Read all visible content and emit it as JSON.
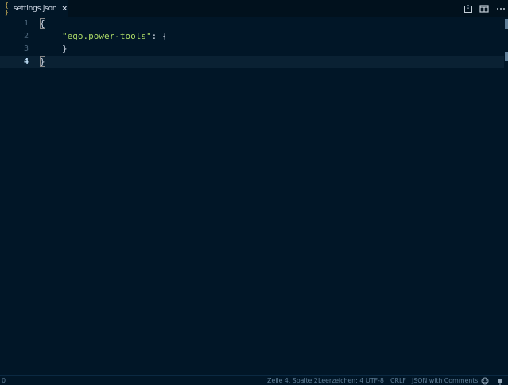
{
  "tab": {
    "icon": "{ }",
    "label": "settings.json",
    "close": "×"
  },
  "editor": {
    "line_numbers": [
      "1",
      "2",
      "3",
      "4"
    ],
    "active_line": "4",
    "lines": {
      "l1": "{",
      "l2_key": "\"ego.power-tools\"",
      "l2_rest": ": {",
      "l3": "}",
      "l4": "}"
    }
  },
  "status": {
    "left": "0",
    "position": "Zeile 4, Spalte 2",
    "indentation": "Leerzeichen: 4",
    "encoding": "UTF-8",
    "eol": "CRLF",
    "language": "JSON with Comments"
  },
  "icons": {
    "compare": "open-changes-icon",
    "split": "split-editor-icon",
    "more": "more-actions-icon",
    "feedback": "smiley-icon",
    "notifications": "bell-icon"
  },
  "colors": {
    "background": "#011627",
    "string": "#addb67",
    "line_number": "#4b6479",
    "active_line_number": "#c5e4fd"
  }
}
